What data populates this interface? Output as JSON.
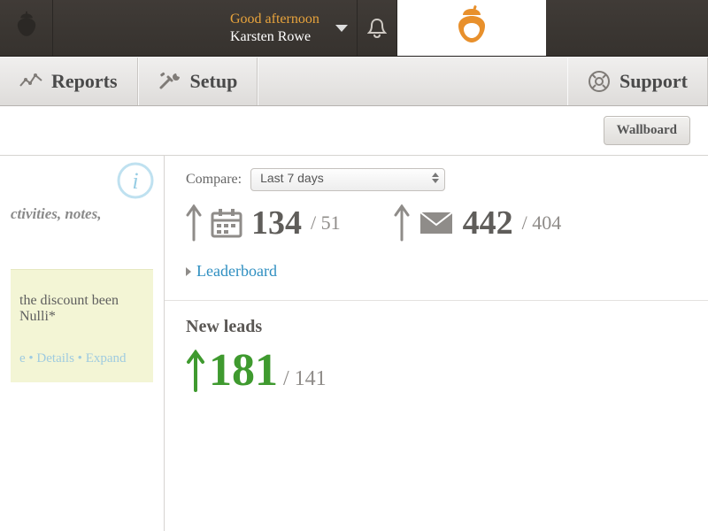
{
  "topbar": {
    "greeting": "Good afternoon",
    "username": "Karsten Rowe"
  },
  "nav": {
    "reports": "Reports",
    "setup": "Setup",
    "support": "Support"
  },
  "subhead": {
    "wallboard": "Wallboard"
  },
  "left": {
    "blurb": "ctivities, notes,",
    "question": "the discount been Nulli*",
    "link_details": "Details",
    "link_expand": "Expand",
    "link_sep1": "e  •  ",
    "link_sep2": "  •  "
  },
  "compare": {
    "label": "Compare:",
    "selected": "Last 7 days"
  },
  "stats": {
    "calendar_value": "134",
    "calendar_compare": "/ 51",
    "mail_value": "442",
    "mail_compare": "/ 404",
    "leaderboard": "Leaderboard"
  },
  "newleads": {
    "title": "New leads",
    "value": "181",
    "compare": "/ 141"
  }
}
